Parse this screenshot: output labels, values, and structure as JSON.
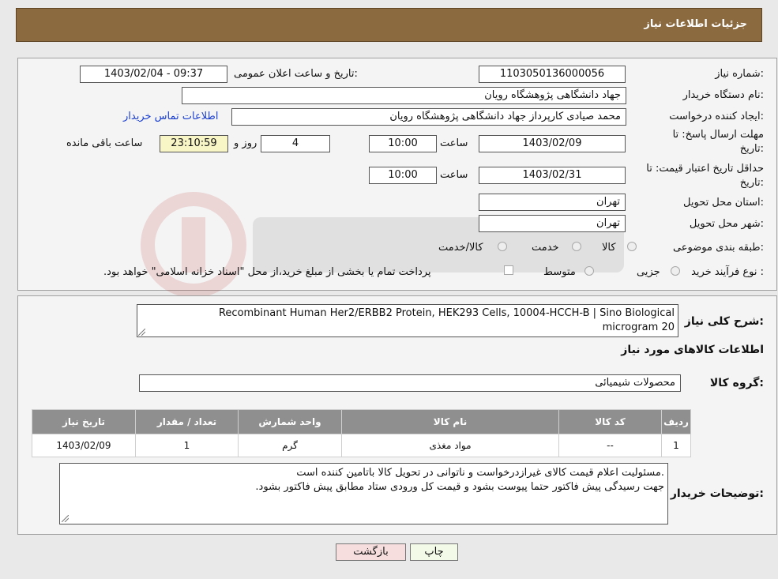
{
  "header": {
    "title": "جزئیات اطلاعات نیاز"
  },
  "form": {
    "need_number_label": "شماره نیاز:",
    "need_number": "1103050136000056",
    "announce_label": "تاریخ و ساعت اعلان عمومی:",
    "announce_value": "1403/02/04 - 09:37",
    "buyer_label": "نام دستگاه خریدار:",
    "buyer_value": "جهاد دانشگاهی پژوهشگاه رویان",
    "creator_label": "ایجاد کننده درخواست:",
    "creator_value": "محمد صیادی کارپرداز جهاد دانشگاهی پژوهشگاه رویان",
    "contact_link": "اطلاعات تماس خریدار",
    "deadline_label_1": "مهلت ارسال پاسخ: تا",
    "deadline_label_2": "تاریخ:",
    "deadline_date": "1403/02/09",
    "time_label": "ساعت",
    "deadline_time": "10:00",
    "days_value": "4",
    "days_label": "روز و",
    "remaining_value": "23:10:59",
    "remaining_label": "ساعت باقی مانده",
    "validity_label_1": "حداقل تاریخ اعتبار قیمت: تا",
    "validity_label_2": "تاریخ:",
    "validity_date": "1403/02/31",
    "validity_time": "10:00",
    "province_label": "استان محل تحویل:",
    "province_value": "تهران",
    "city_label": "شهر محل تحویل:",
    "city_value": "تهران",
    "category_label": "طبقه بندی موضوعی:",
    "category_options": [
      "کالا",
      "خدمت",
      "کالا/خدمت"
    ],
    "purchase_label": "نوع فرآیند خرید :",
    "purchase_options": [
      "جزیی",
      "متوسط"
    ],
    "purchase_note": "پرداخت تمام یا بخشی از مبلغ خرید،از محل \"اسناد خزانه اسلامی\" خواهد بود."
  },
  "details": {
    "description_label": "شرح کلی نیاز:",
    "description_line1": "Recombinant Human Her2/ERBB2 Protein, HEK293 Cells, 10004-HCCH-B | Sino Biological",
    "description_line2": "20 microgram",
    "items_title": "اطلاعات کالاهای مورد نیاز",
    "group_label": "گروه کالا:",
    "group_value": "محصولات شیمیائی",
    "table": {
      "headers": [
        "ردیف",
        "کد کالا",
        "نام کالا",
        "واحد شمارش",
        "تعداد / مقدار",
        "تاریخ نیاز"
      ],
      "rows": [
        [
          "1",
          "--",
          "مواد مغذی",
          "گرم",
          "1",
          "1403/02/09"
        ]
      ]
    },
    "notes_label": "توضیحات خریدار:",
    "notes_line1": ".مسئولیت اعلام قیمت کالای غیرازدرخواست و ناتوانی در تحویل کالا باتامین کننده است",
    "notes_line2": "جهت رسیدگی پیش فاکتور حتما پیوست بشود و قیمت کل ورودی ستاد مطابق پیش فاکتور بشود."
  },
  "buttons": {
    "print": "چاپ",
    "back": "بازگشت"
  },
  "colors": {
    "header": "#8b6a3f",
    "back_button": "#f6dede",
    "print_button": "#f3fbe8",
    "link": "#1a3fd0"
  }
}
